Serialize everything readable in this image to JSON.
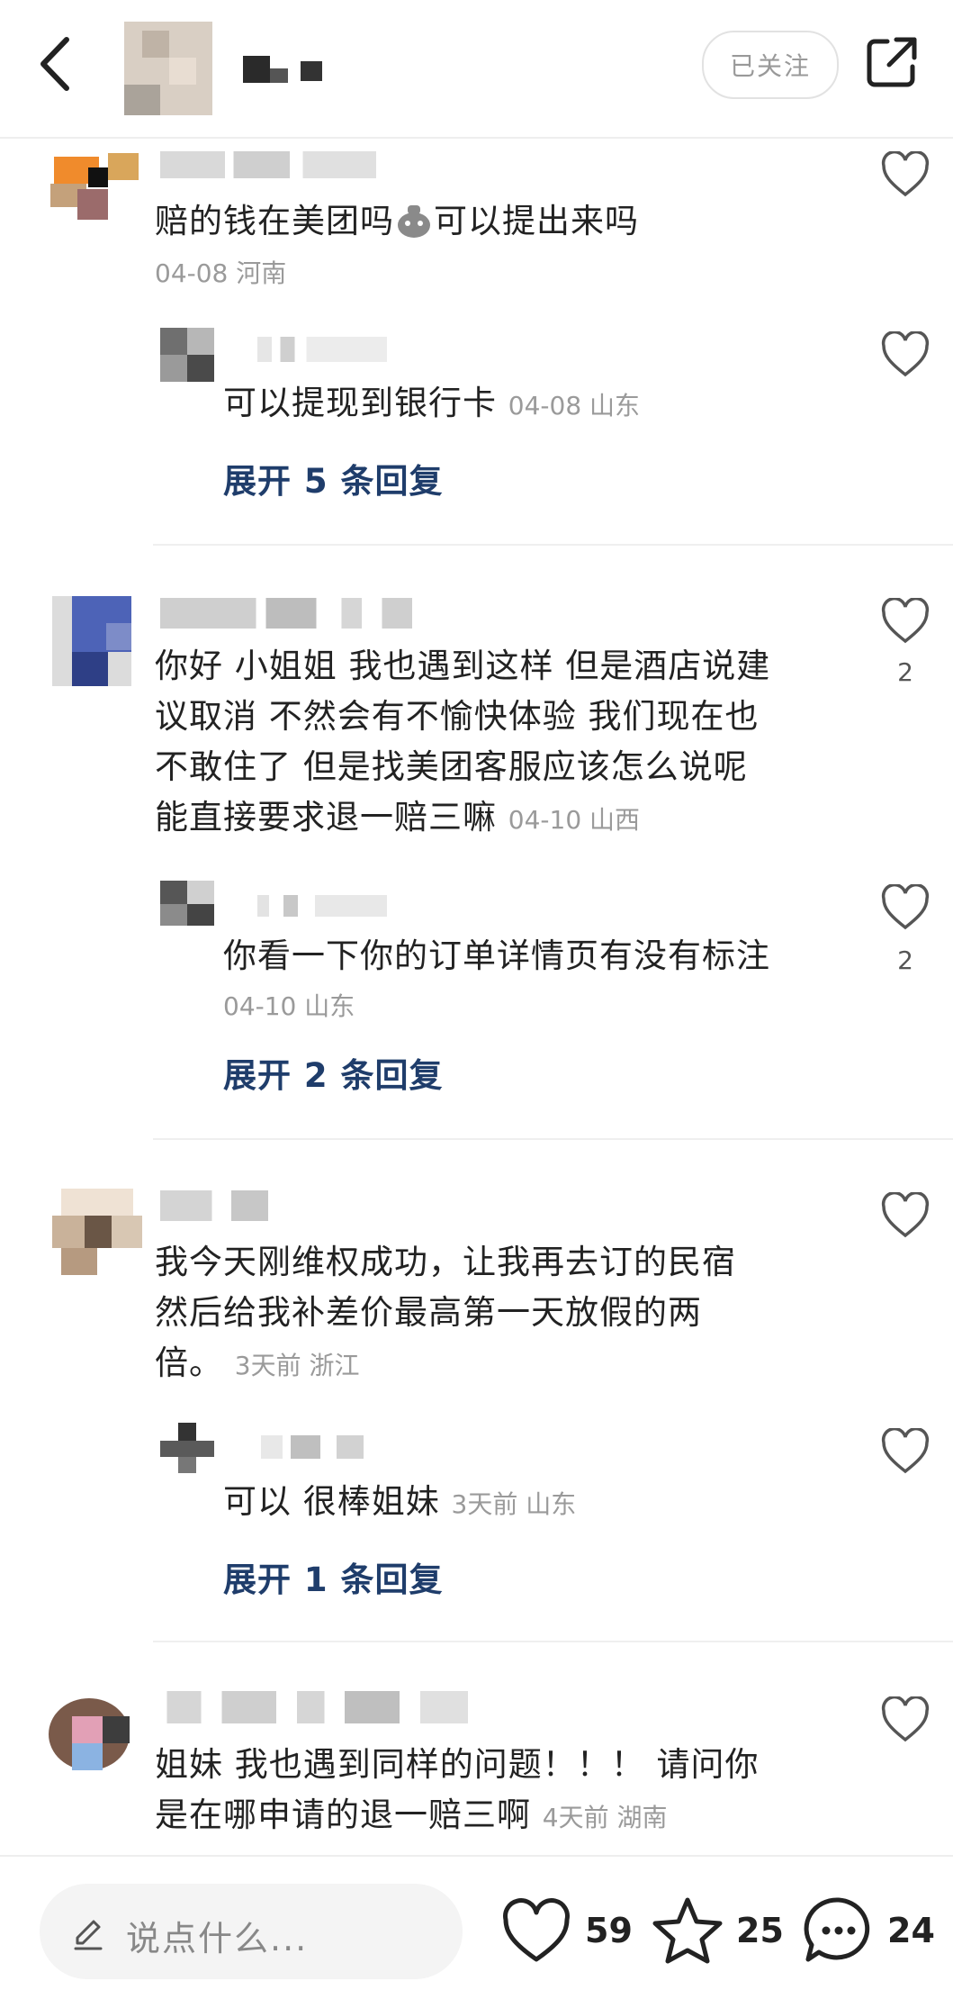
{
  "header": {
    "follow_label": "已关注"
  },
  "comments": [
    {
      "text": "赔的钱在美团吗",
      "text_after_emoji": "可以提出来吗",
      "emoji": "money-bag-emoji",
      "meta": "04-08 河南",
      "reply": {
        "text": "可以提现到银行卡",
        "meta": "04-08 山东"
      },
      "expand": "展开 5 条回复"
    },
    {
      "lines": [
        "你好 小姐姐 我也遇到这样 但是酒店说建",
        "议取消 不然会有不愉快体验 我们现在也",
        "不敢住了 但是找美团客服应该怎么说呢",
        "能直接要求退一赔三嘛"
      ],
      "meta": "04-10 山西",
      "likes": "2",
      "reply": {
        "text": "你看一下你的订单详情页有没有标注",
        "meta": "04-10 山东",
        "likes": "2"
      },
      "expand": "展开 2 条回复"
    },
    {
      "lines": [
        "我今天刚维权成功，让我再去订的民宿",
        "然后给我补差价最高第一天放假的两",
        "倍。"
      ],
      "meta": "3天前 浙江",
      "reply": {
        "text": "可以 很棒姐妹",
        "meta": "3天前 山东"
      },
      "expand": "展开 1 条回复"
    },
    {
      "lines": [
        "姐妹 我也遇到同样的问题！！！ 请问你",
        "是在哪申请的退一赔三啊"
      ],
      "meta": "4天前 湖南"
    }
  ],
  "bottom": {
    "placeholder": "说点什么...",
    "like_count": "59",
    "star_count": "25",
    "comment_count": "24",
    "icons": [
      "pencil-icon",
      "heart-icon",
      "star-icon",
      "comment-icon"
    ]
  },
  "colors": {
    "link": "#1f3d6b",
    "meta": "#9a9a9a"
  }
}
